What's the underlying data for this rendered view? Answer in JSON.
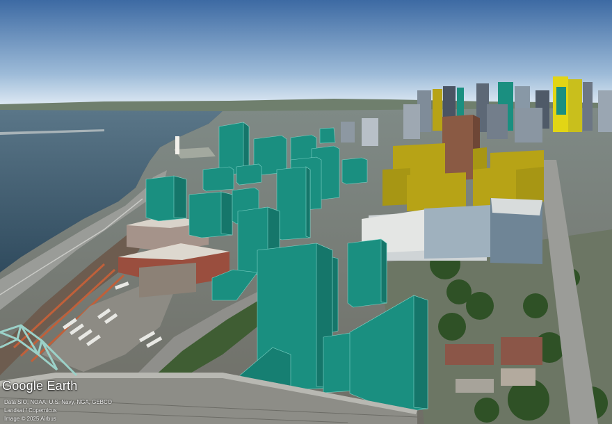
{
  "branding": {
    "logo_text": "Google Earth"
  },
  "attribution": {
    "line1": "Data SIO, NOAA, U.S. Navy, NGA, GEBCO",
    "line2": "Landsat / Copernicus",
    "line3": "Image © 2025 Airbus"
  },
  "colors": {
    "proposed_building": "#1a8f80",
    "proposed_building_light": "#2aa898",
    "existing_highlight": "#b7a316",
    "sky_top": "#3d6aa3",
    "sky_horizon": "#dfeaf4",
    "river": "#3b5970"
  }
}
